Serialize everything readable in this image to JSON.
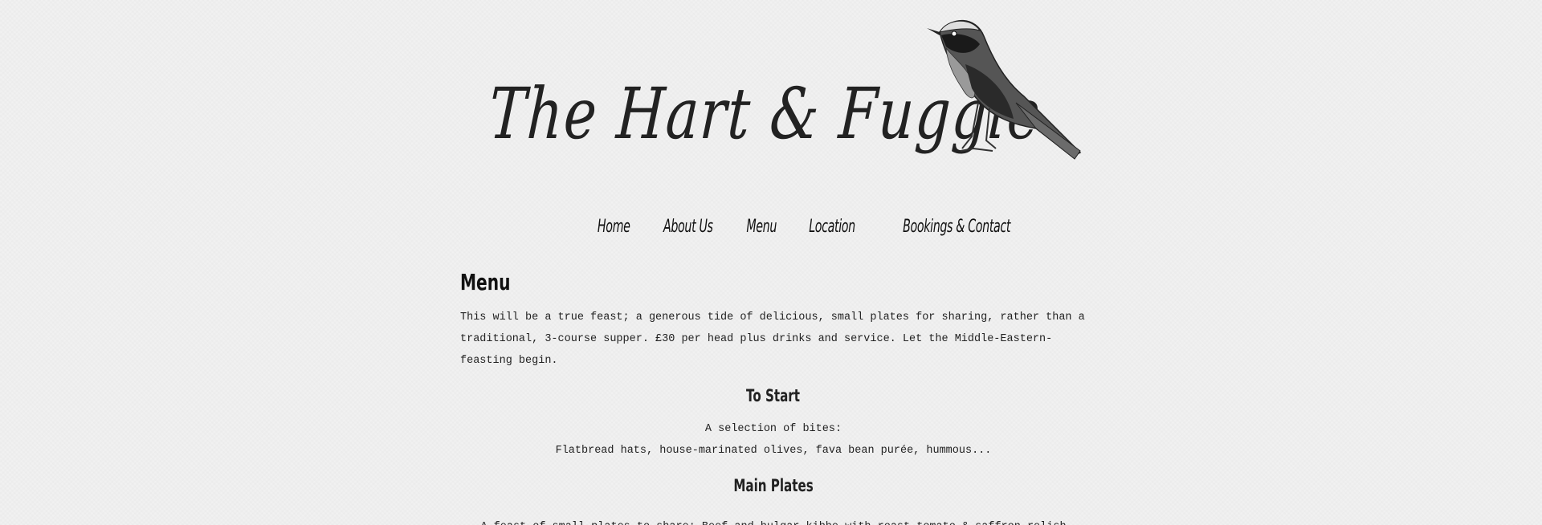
{
  "brand": {
    "title": "The Hart & Fuggle"
  },
  "nav": {
    "items": [
      {
        "label": "Home"
      },
      {
        "label": "About Us"
      },
      {
        "label": "Menu"
      },
      {
        "label": "Location"
      },
      {
        "label": "Bookings & Contact"
      }
    ]
  },
  "page": {
    "title": "Menu",
    "intro": "This will be a true feast; a generous tide of delicious, small plates for sharing, rather than a traditional, 3-course supper. £30 per head plus drinks and service. Let the Middle-Eastern-feasting begin."
  },
  "sections": [
    {
      "heading": "To Start",
      "lines": [
        "A selection of bites:",
        "Flatbread hats, house-marinated olives, fava bean purée, hummous..."
      ]
    },
    {
      "heading": "Main Plates",
      "lines": [
        "A feast of small plates to share: Beef and bulgar kibbe with roast tomato & saffron relish"
      ]
    }
  ]
}
